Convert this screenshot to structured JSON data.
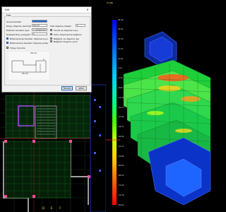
{
  "dialog": {
    "title": "Edit",
    "close_glyph": "✕",
    "group_label": "Edit",
    "fields": [
      {
        "label": "Dosis bardaklı",
        "value": ""
      },
      {
        "label": "Dolgu döşeme derinliği",
        "value": "20 cm"
      },
      {
        "label": "Ekstrem beraber ayar",
        "value": "1 dimension"
      },
      {
        "label": "Ruslaştırılmış yüzeyleri",
        "value": "1"
      }
    ],
    "right_fields": [
      {
        "label": "Hati döşeme hesabı",
        "value": "1"
      },
      {
        "label": "Yonalt ile döşeme kuyu",
        "checked": true
      },
      {
        "label": "Kolor döşemesine bağlanır",
        "checked": false
      },
      {
        "label": "Bağlantı ve döşeme dışı",
        "checked": false
      },
      {
        "label": "Bağlantı döşeme yönü",
        "checked": false
      }
    ],
    "checkboxes": [
      {
        "label": "Bütünlenmeş beraber döşeme kuyu",
        "checked": true
      },
      {
        "label": "Bütünlenmiş beraber döşeme yüzler",
        "checked": true
      },
      {
        "label": "Yüzey donukla",
        "checked": false
      }
    ],
    "preview_labels": {
      "top": "20 cm",
      "side": "1",
      "bottom": "20 cm"
    },
    "buttons": {
      "cancel": "Tamam",
      "ok": "iptal"
    }
  },
  "view3d": {
    "header": "Fz (kN)",
    "colorbar_ticks": [
      "36.36",
      "29.93",
      "23.50",
      "17.07",
      "10.64",
      "4.21",
      "-2.22",
      "-8.65",
      "-15.08",
      "-21.51",
      "-27.94",
      "-34.37",
      "-40.80",
      "-47.23",
      "-53.66",
      "-60.09",
      "-66.52",
      "-72.95",
      "-79.38",
      "-85.81"
    ]
  },
  "cad": {
    "grid_labels_bottom": [
      "D",
      "E",
      "F"
    ],
    "grid_labels_left": [
      "1",
      "2",
      "3"
    ]
  },
  "colors": {
    "dialog_bg": "#f0f0f0",
    "accent": "#1e64c8",
    "cad_bg": "#000000",
    "label_yellow": "#ffd84a"
  }
}
